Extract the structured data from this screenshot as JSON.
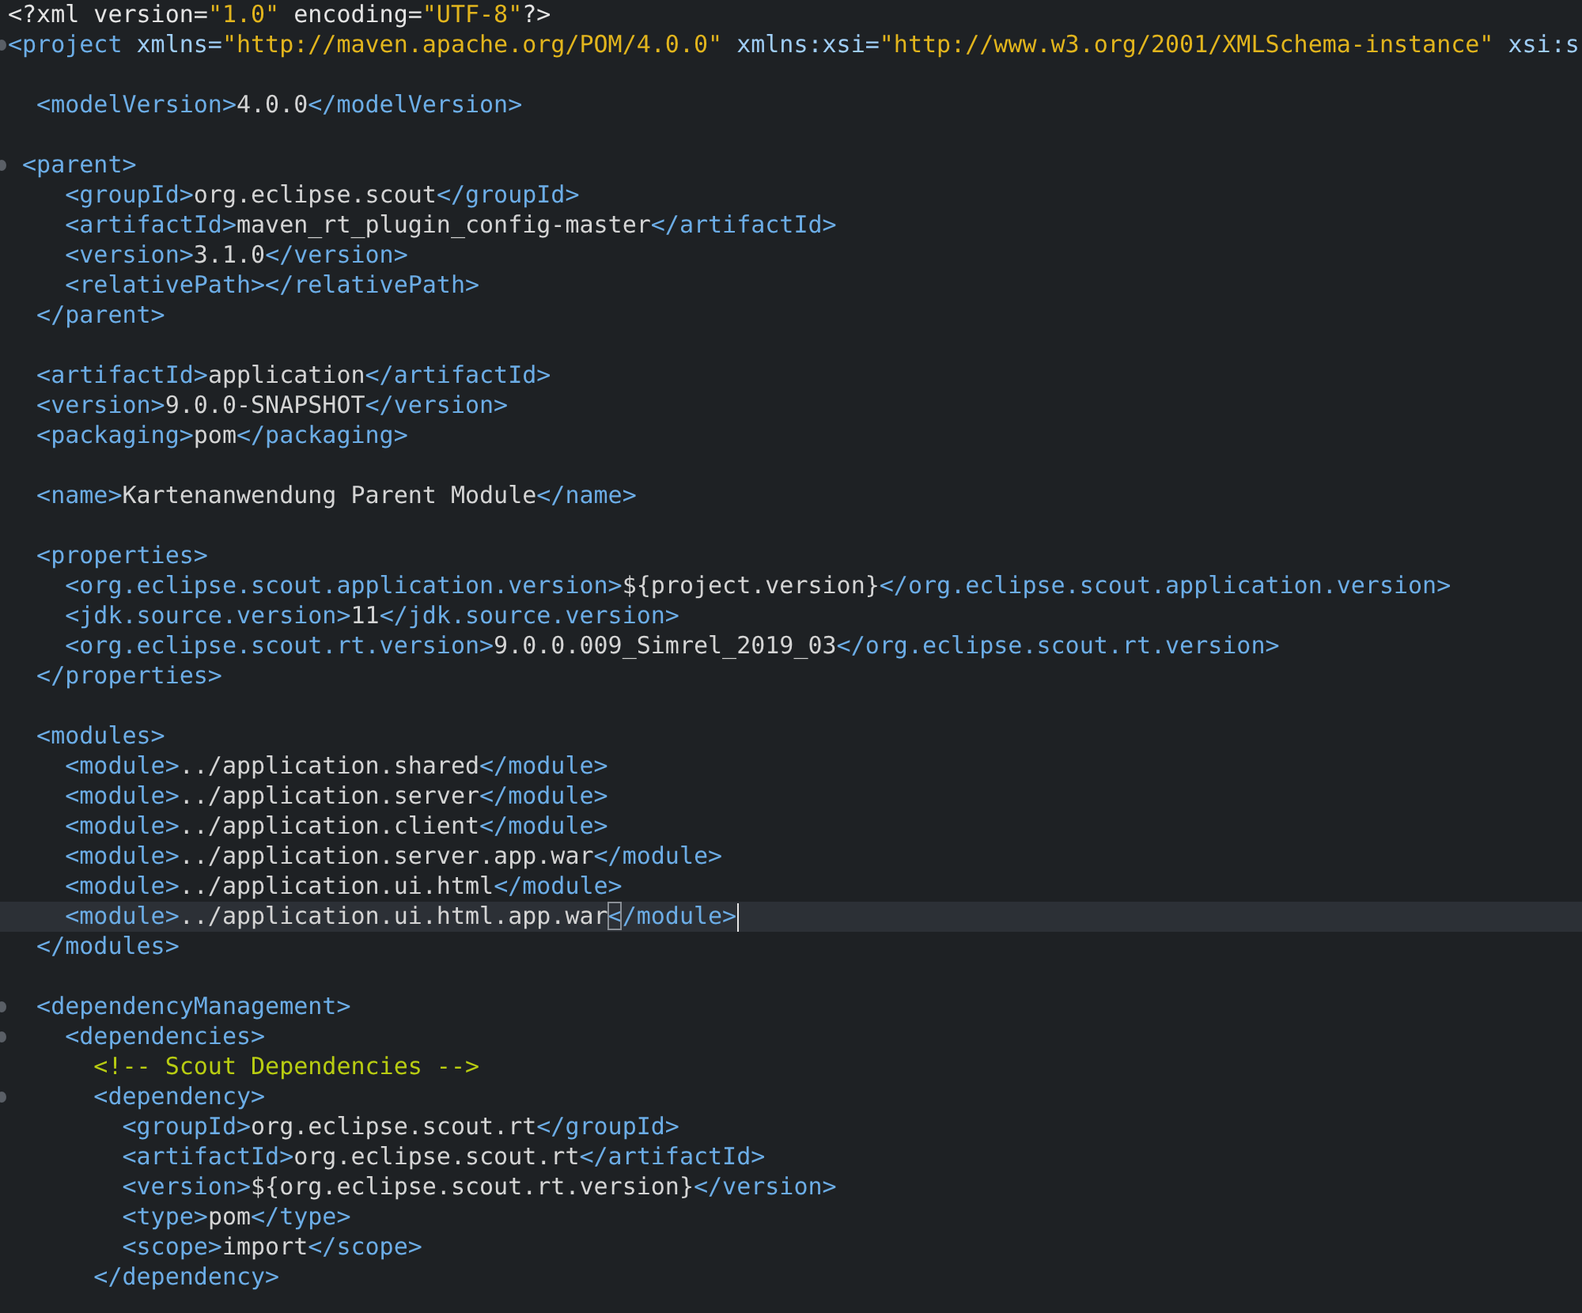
{
  "lines": [
    {
      "kind": "code",
      "foldable": false,
      "selected": false,
      "segments": [
        {
          "kind": "decl",
          "text": "<?xml version="
        },
        {
          "kind": "value",
          "text": "\"1.0\""
        },
        {
          "kind": "decl",
          "text": " encoding="
        },
        {
          "kind": "value",
          "text": "\"UTF-8\""
        },
        {
          "kind": "decl",
          "text": "?>"
        }
      ]
    },
    {
      "kind": "code",
      "foldable": true,
      "selected": false,
      "segments": [
        {
          "kind": "tag",
          "text": "<project"
        },
        {
          "kind": "attr",
          "text": " xmlns="
        },
        {
          "kind": "value",
          "text": "\"http://maven.apache.org/POM/4.0.0\""
        },
        {
          "kind": "attr",
          "text": " xmlns:xsi="
        },
        {
          "kind": "value",
          "text": "\"http://www.w3.org/2001/XMLSchema-instance\""
        },
        {
          "kind": "attr",
          "text": " xsi:s"
        }
      ]
    },
    {
      "kind": "blank"
    },
    {
      "kind": "code",
      "foldable": false,
      "selected": false,
      "segments": [
        {
          "kind": "tag",
          "text": "  <modelVersion>"
        },
        {
          "kind": "text",
          "text": "4.0.0"
        },
        {
          "kind": "tag",
          "text": "</modelVersion>"
        }
      ]
    },
    {
      "kind": "blank"
    },
    {
      "kind": "code",
      "foldable": true,
      "selected": false,
      "segments": [
        {
          "kind": "tag",
          "text": " <parent>"
        }
      ]
    },
    {
      "kind": "code",
      "foldable": false,
      "selected": false,
      "segments": [
        {
          "kind": "tag",
          "text": "    <groupId>"
        },
        {
          "kind": "text",
          "text": "org.eclipse.scout"
        },
        {
          "kind": "tag",
          "text": "</groupId>"
        }
      ]
    },
    {
      "kind": "code",
      "foldable": false,
      "selected": false,
      "segments": [
        {
          "kind": "tag",
          "text": "    <artifactId>"
        },
        {
          "kind": "text",
          "text": "maven_rt_plugin_config-master"
        },
        {
          "kind": "tag",
          "text": "</artifactId>"
        }
      ]
    },
    {
      "kind": "code",
      "foldable": false,
      "selected": false,
      "segments": [
        {
          "kind": "tag",
          "text": "    <version>"
        },
        {
          "kind": "text",
          "text": "3.1.0"
        },
        {
          "kind": "tag",
          "text": "</version>"
        }
      ]
    },
    {
      "kind": "code",
      "foldable": false,
      "selected": false,
      "segments": [
        {
          "kind": "tag",
          "text": "    <relativePath></relativePath>"
        }
      ]
    },
    {
      "kind": "code",
      "foldable": false,
      "selected": false,
      "segments": [
        {
          "kind": "tag",
          "text": "  </parent>"
        }
      ]
    },
    {
      "kind": "blank"
    },
    {
      "kind": "code",
      "foldable": false,
      "selected": false,
      "segments": [
        {
          "kind": "tag",
          "text": "  <artifactId>"
        },
        {
          "kind": "text",
          "text": "application"
        },
        {
          "kind": "tag",
          "text": "</artifactId>"
        }
      ]
    },
    {
      "kind": "code",
      "foldable": false,
      "selected": false,
      "segments": [
        {
          "kind": "tag",
          "text": "  <version>"
        },
        {
          "kind": "text",
          "text": "9.0.0-SNAPSHOT"
        },
        {
          "kind": "tag",
          "text": "</version>"
        }
      ]
    },
    {
      "kind": "code",
      "foldable": false,
      "selected": false,
      "segments": [
        {
          "kind": "tag",
          "text": "  <packaging>"
        },
        {
          "kind": "text",
          "text": "pom"
        },
        {
          "kind": "tag",
          "text": "</packaging>"
        }
      ]
    },
    {
      "kind": "blank"
    },
    {
      "kind": "code",
      "foldable": false,
      "selected": false,
      "segments": [
        {
          "kind": "tag",
          "text": "  <name>"
        },
        {
          "kind": "text",
          "text": "Kartenanwendung Parent Module"
        },
        {
          "kind": "tag",
          "text": "</name>"
        }
      ]
    },
    {
      "kind": "blank"
    },
    {
      "kind": "code",
      "foldable": false,
      "selected": false,
      "segments": [
        {
          "kind": "tag",
          "text": "  <properties>"
        }
      ]
    },
    {
      "kind": "code",
      "foldable": false,
      "selected": false,
      "segments": [
        {
          "kind": "tag",
          "text": "    <org.eclipse.scout.application.version>"
        },
        {
          "kind": "text",
          "text": "${project.version}"
        },
        {
          "kind": "tag",
          "text": "</org.eclipse.scout.application.version>"
        }
      ]
    },
    {
      "kind": "code",
      "foldable": false,
      "selected": false,
      "segments": [
        {
          "kind": "tag",
          "text": "    <jdk.source.version>"
        },
        {
          "kind": "text",
          "text": "11"
        },
        {
          "kind": "tag",
          "text": "</jdk.source.version>"
        }
      ]
    },
    {
      "kind": "code",
      "foldable": false,
      "selected": false,
      "segments": [
        {
          "kind": "tag",
          "text": "    <org.eclipse.scout.rt.version>"
        },
        {
          "kind": "text",
          "text": "9.0.0.009_Simrel_2019_03"
        },
        {
          "kind": "tag",
          "text": "</org.eclipse.scout.rt.version>"
        }
      ]
    },
    {
      "kind": "code",
      "foldable": false,
      "selected": false,
      "segments": [
        {
          "kind": "tag",
          "text": "  </properties>"
        }
      ]
    },
    {
      "kind": "blank"
    },
    {
      "kind": "code",
      "foldable": false,
      "selected": false,
      "segments": [
        {
          "kind": "tag",
          "text": "  <modules>"
        }
      ]
    },
    {
      "kind": "code",
      "foldable": false,
      "selected": false,
      "segments": [
        {
          "kind": "tag",
          "text": "    <module>"
        },
        {
          "kind": "text",
          "text": "../application.shared"
        },
        {
          "kind": "tag",
          "text": "</module>"
        }
      ]
    },
    {
      "kind": "code",
      "foldable": false,
      "selected": false,
      "segments": [
        {
          "kind": "tag",
          "text": "    <module>"
        },
        {
          "kind": "text",
          "text": "../application.server"
        },
        {
          "kind": "tag",
          "text": "</module>"
        }
      ]
    },
    {
      "kind": "code",
      "foldable": false,
      "selected": false,
      "segments": [
        {
          "kind": "tag",
          "text": "    <module>"
        },
        {
          "kind": "text",
          "text": "../application.client"
        },
        {
          "kind": "tag",
          "text": "</module>"
        }
      ]
    },
    {
      "kind": "code",
      "foldable": false,
      "selected": false,
      "segments": [
        {
          "kind": "tag",
          "text": "    <module>"
        },
        {
          "kind": "text",
          "text": "../application.server.app.war"
        },
        {
          "kind": "tag",
          "text": "</module>"
        }
      ]
    },
    {
      "kind": "code",
      "foldable": false,
      "selected": false,
      "segments": [
        {
          "kind": "tag",
          "text": "    <module>"
        },
        {
          "kind": "text",
          "text": "../application.ui.html"
        },
        {
          "kind": "tag",
          "text": "</module>"
        }
      ]
    },
    {
      "kind": "code",
      "foldable": false,
      "selected": true,
      "segments": [
        {
          "kind": "tag",
          "text": "    <module>"
        },
        {
          "kind": "text",
          "text": "../application.ui.html.app.war"
        },
        {
          "kind": "match",
          "text": "<"
        },
        {
          "kind": "tag",
          "text": "/module>"
        }
      ]
    },
    {
      "kind": "code",
      "foldable": false,
      "selected": false,
      "segments": [
        {
          "kind": "tag",
          "text": "  </modules>"
        }
      ]
    },
    {
      "kind": "blank"
    },
    {
      "kind": "code",
      "foldable": true,
      "selected": false,
      "segments": [
        {
          "kind": "tag",
          "text": "  <dependencyManagement>"
        }
      ]
    },
    {
      "kind": "code",
      "foldable": true,
      "selected": false,
      "segments": [
        {
          "kind": "tag",
          "text": "    <dependencies>"
        }
      ]
    },
    {
      "kind": "code",
      "foldable": false,
      "selected": false,
      "segments": [
        {
          "kind": "comment",
          "text": "      <!-- Scout Dependencies -->"
        }
      ]
    },
    {
      "kind": "code",
      "foldable": true,
      "selected": false,
      "segments": [
        {
          "kind": "tag",
          "text": "      <dependency>"
        }
      ]
    },
    {
      "kind": "code",
      "foldable": false,
      "selected": false,
      "segments": [
        {
          "kind": "tag",
          "text": "        <groupId>"
        },
        {
          "kind": "text",
          "text": "org.eclipse.scout.rt"
        },
        {
          "kind": "tag",
          "text": "</groupId>"
        }
      ]
    },
    {
      "kind": "code",
      "foldable": false,
      "selected": false,
      "segments": [
        {
          "kind": "tag",
          "text": "        <artifactId>"
        },
        {
          "kind": "text",
          "text": "org.eclipse.scout.rt"
        },
        {
          "kind": "tag",
          "text": "</artifactId>"
        }
      ]
    },
    {
      "kind": "code",
      "foldable": false,
      "selected": false,
      "segments": [
        {
          "kind": "tag",
          "text": "        <version>"
        },
        {
          "kind": "text",
          "text": "${org.eclipse.scout.rt.version}"
        },
        {
          "kind": "tag",
          "text": "</version>"
        }
      ]
    },
    {
      "kind": "code",
      "foldable": false,
      "selected": false,
      "segments": [
        {
          "kind": "tag",
          "text": "        <type>"
        },
        {
          "kind": "text",
          "text": "pom"
        },
        {
          "kind": "tag",
          "text": "</type>"
        }
      ]
    },
    {
      "kind": "code",
      "foldable": false,
      "selected": false,
      "segments": [
        {
          "kind": "tag",
          "text": "        <scope>"
        },
        {
          "kind": "text",
          "text": "import"
        },
        {
          "kind": "tag",
          "text": "</scope>"
        }
      ]
    },
    {
      "kind": "code",
      "foldable": false,
      "selected": false,
      "segments": [
        {
          "kind": "tag",
          "text": "      </dependency>"
        }
      ]
    }
  ]
}
